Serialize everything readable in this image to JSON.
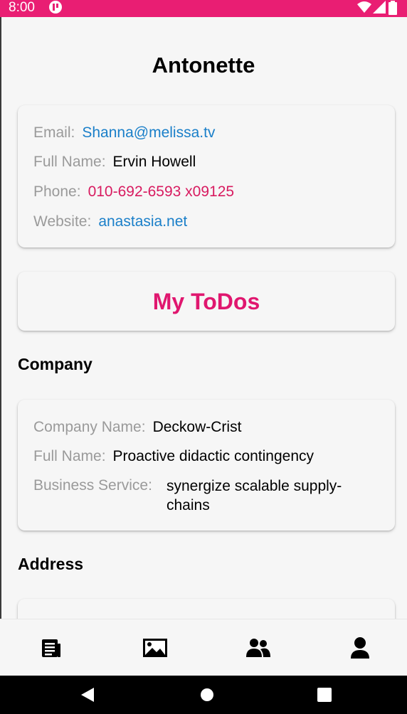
{
  "status_bar": {
    "time": "8:00",
    "icons": [
      "notification-app-icon",
      "wifi-icon",
      "signal-icon",
      "battery-icon"
    ]
  },
  "profile": {
    "username": "Antonette",
    "contact": {
      "email_label": "Email:",
      "email": "Shanna@melissa.tv",
      "full_name_label": "Full Name:",
      "full_name": "Ervin Howell",
      "phone_label": "Phone:",
      "phone": "010-692-6593 x09125",
      "website_label": "Website:",
      "website": "anastasia.net"
    },
    "todos_label": "My ToDos",
    "company_heading": "Company",
    "company": {
      "name_label": "Company Name:",
      "name": "Deckow-Crist",
      "full_name_label": "Full Name:",
      "full_name": "Proactive didactic contingency",
      "service_label": "Business Service:",
      "service": "synergize scalable supply-chains"
    },
    "address_heading": "Address"
  },
  "bottom_nav": {
    "items": [
      "posts-icon",
      "photos-icon",
      "users-icon",
      "profile-icon"
    ]
  },
  "colors": {
    "accent": "#e91e73",
    "link": "#1a7fc9",
    "phone": "#d81b60"
  }
}
